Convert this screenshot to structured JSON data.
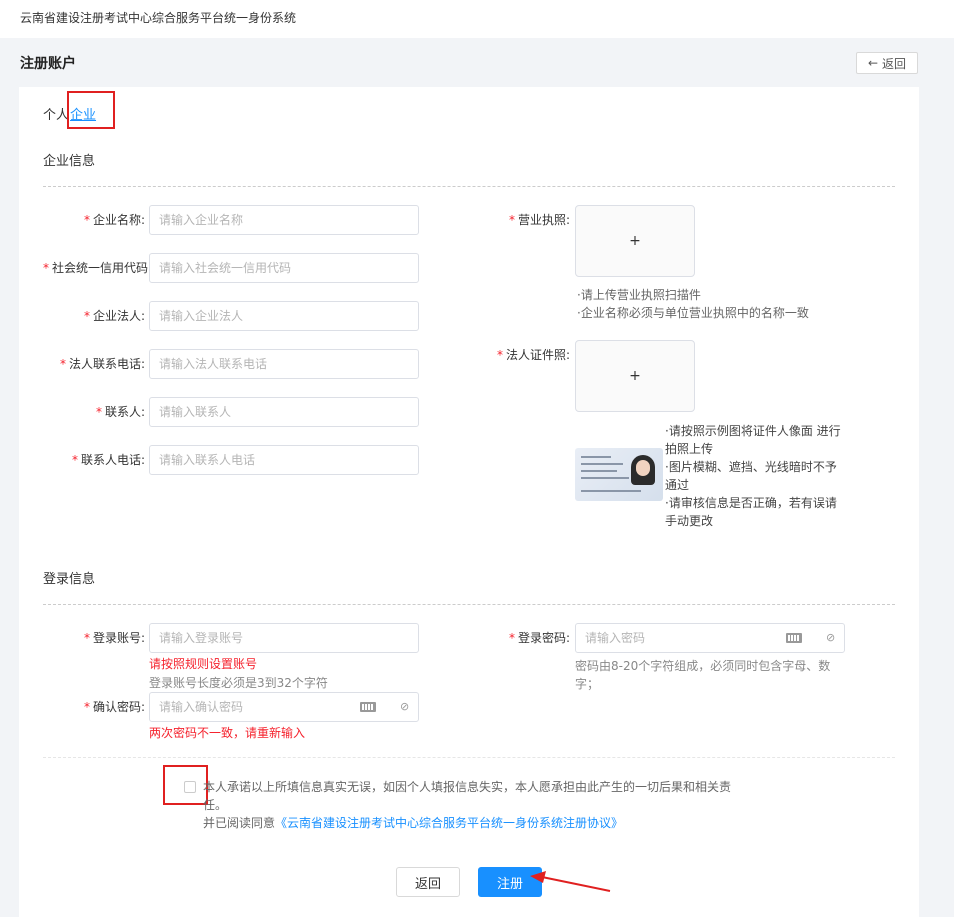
{
  "app": {
    "title": "云南省建设注册考试中心综合服务平台统一身份系统"
  },
  "header": {
    "page_title": "注册账户",
    "back_label": "返回",
    "back_icon": "arrow-left-icon"
  },
  "tabs": {
    "person": "个人",
    "company": "企业"
  },
  "company_section": {
    "title": "企业信息",
    "fields": [
      {
        "label": "企业名称:",
        "placeholder": "请输入企业名称"
      },
      {
        "label": "社会统一信用代码",
        "placeholder": "请输入社会统一信用代码"
      },
      {
        "label": "企业法人:",
        "placeholder": "请输入企业法人"
      },
      {
        "label": "法人联系电话:",
        "placeholder": "请输入法人联系电话"
      },
      {
        "label": "联系人:",
        "placeholder": "请输入联系人"
      },
      {
        "label": "联系人电话:",
        "placeholder": "请输入联系人电话"
      }
    ],
    "license": {
      "label": "营业执照:",
      "plus": "+",
      "hints": [
        "请上传营业执照扫描件",
        "企业名称必须与单位营业执照中的名称一致"
      ]
    },
    "legal_id": {
      "label": "法人证件照:",
      "plus": "+",
      "hints": [
        "请按照示例图将证件人像面 进行拍照上传",
        "图片模糊、遮挡、光线暗时不予通过",
        "请审核信息是否正确，若有误请手动更改"
      ]
    }
  },
  "login_section": {
    "title": "登录信息",
    "account": {
      "label": "登录账号:",
      "placeholder": "请输入登录账号",
      "error": "请按照规则设置账号",
      "hint": "登录账号长度必须是3到32个字符"
    },
    "password": {
      "label": "登录密码:",
      "placeholder": "请输入密码",
      "hint": "密码由8-20个字符组成，必须同时包含字母、数字；"
    },
    "confirm": {
      "label": "确认密码:",
      "placeholder": "请输入确认密码",
      "error": "两次密码不一致，请重新输入"
    }
  },
  "agreement": {
    "text": "本人承诺以上所填信息真实无误，如因个人填报信息失实，本人愿承担由此产生的一切后果和相关责任。",
    "read_prefix": "并已阅读同意",
    "link": "《云南省建设注册考试中心综合服务平台统一身份系统注册协议》"
  },
  "actions": {
    "back": "返回",
    "register": "注册"
  },
  "colors": {
    "primary": "#1890ff",
    "required": "#f5222d",
    "annotation": "#e02020"
  }
}
